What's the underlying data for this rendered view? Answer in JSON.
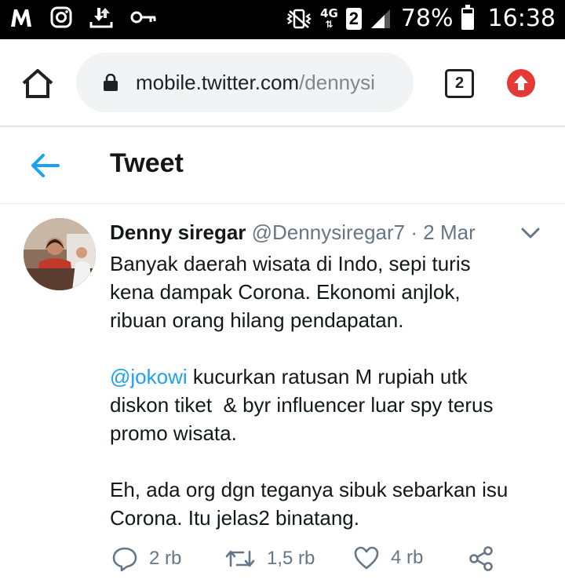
{
  "status_bar": {
    "network": "4G",
    "sim": "2",
    "battery": "78%",
    "battery_level": 0.78,
    "time": "16:38",
    "icons": [
      "app-icon-m",
      "instagram-icon",
      "download-icon",
      "key-icon",
      "vibrate-icon",
      "signal-icon",
      "battery-icon"
    ]
  },
  "browser": {
    "url_host": "mobile.twitter.com",
    "url_path": "/dennysi",
    "tab_count": "2",
    "icons": [
      "home-icon",
      "lock-icon",
      "update-icon"
    ]
  },
  "header": {
    "title": "Tweet",
    "back_icon": "back-arrow-icon"
  },
  "tweet": {
    "author_name": "Denny siregar",
    "handle": "@Dennysiregar7",
    "separator": "·",
    "date": "2 Mar",
    "line1": "Banyak daerah wisata di Indo, sepi turis",
    "line2": "kena dampak Corona. Ekonomi anjlok,",
    "line3": "ribuan orang hilang pendapatan.",
    "mention": "@jokowi",
    "line4_rest": " kucurkan ratusan M rupiah utk",
    "line5": "diskon tiket  & byr influencer luar spy terus",
    "line6": "promo wisata.",
    "line7": "Eh, ada org dgn teganya sibuk sebarkan isu",
    "line8": "Corona. Itu jelas2 binatang."
  },
  "actions": {
    "replies": "2 rb",
    "retweets": "1,5 rb",
    "likes": "4 rb"
  },
  "colors": {
    "accent": "#1da1f2",
    "update": "#e53935",
    "muted": "#657786"
  }
}
